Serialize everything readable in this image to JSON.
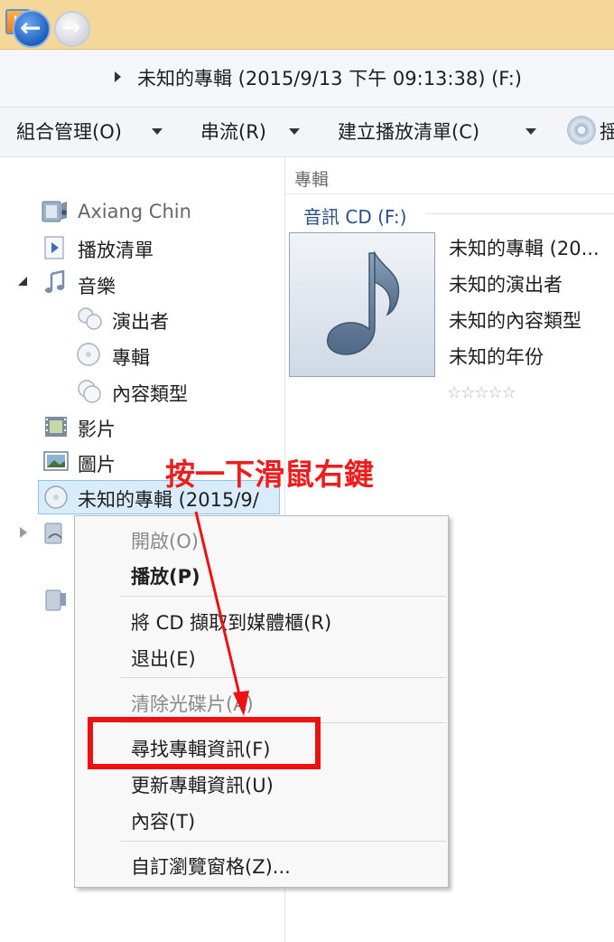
{
  "address_bar": {
    "breadcrumb": "未知的專輯 (2015/9/13 下午 09:13:38) (F:)"
  },
  "toolbar": {
    "organize": "組合管理(O)",
    "stream": "串流(R)",
    "create_playlist": "建立播放清單(C)",
    "cut_label": "揺"
  },
  "nav": {
    "user": "Axiang Chin",
    "playlists": "播放清單",
    "music": "音樂",
    "artist": "演出者",
    "album": "專輯",
    "genre": "內容類型",
    "videos": "影片",
    "pictures": "圖片",
    "cd": "未知的專輯 (2015/9/"
  },
  "content": {
    "column_header": "專輯",
    "group": "音訊 CD (F:)",
    "album_title": "未知的專輯 (20...",
    "artist": "未知的演出者",
    "genre": "未知的內容類型",
    "year": "未知的年份",
    "rating_stars": "☆☆☆☆☆"
  },
  "annotation": {
    "text": "按一下滑鼠右鍵",
    "color": "#ee1c1c"
  },
  "context_menu": {
    "open": "開啟(O)",
    "play": "播放(P)",
    "rip": "將 CD 擷取到媒體櫃(R)",
    "eject": "退出(E)",
    "clear": "清除光碟片(A)",
    "find_album_info": "尋找專輯資訊(F)",
    "update_album_info": "更新專輯資訊(U)",
    "properties": "內容(T)",
    "customize": "自訂瀏覽窗格(Z)..."
  },
  "colors": {
    "title_bar": "#f5d79a",
    "selection": "#d9ecfb",
    "highlight": "#ee1111"
  }
}
